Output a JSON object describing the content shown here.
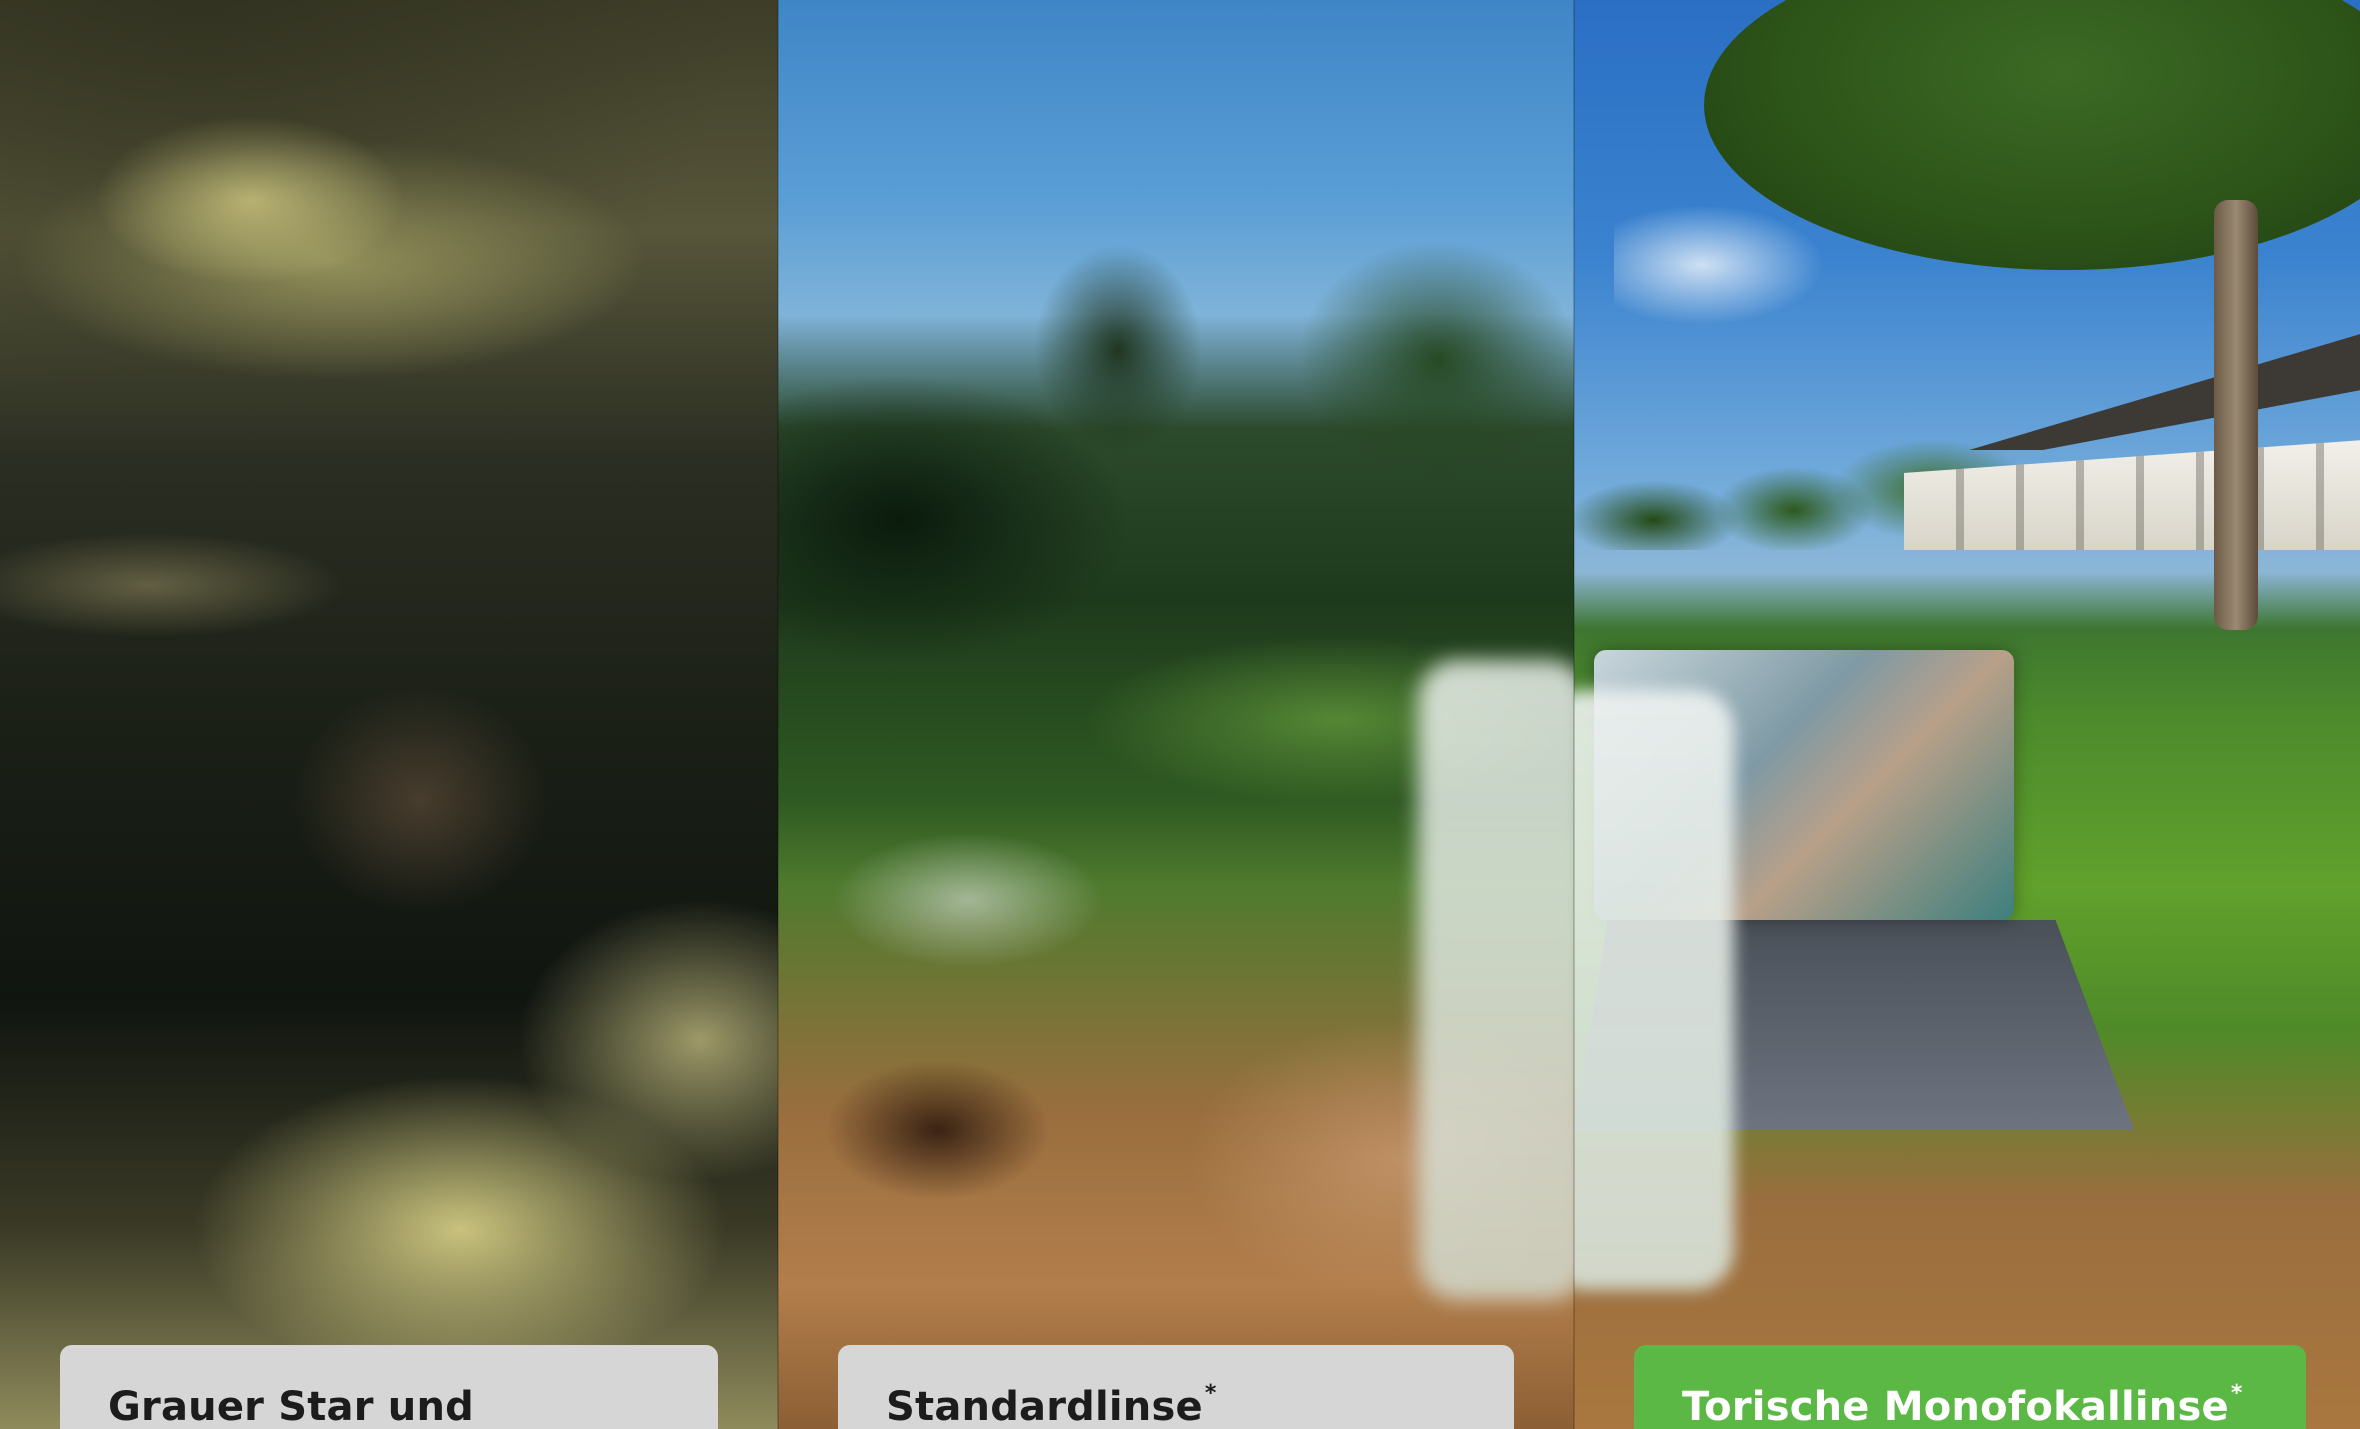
{
  "panels": [
    {
      "id": "cataract",
      "label": "Grauer Star und",
      "marker": "",
      "highlighted": false,
      "label_bg": "#d6d6d6",
      "label_color": "#1c1c1c"
    },
    {
      "id": "standard",
      "label": "Standardlinse",
      "marker": "*",
      "highlighted": false,
      "label_bg": "#d6d6d6",
      "label_color": "#1c1c1c"
    },
    {
      "id": "toric",
      "label": "Torische Monofokallinse",
      "marker": "*",
      "highlighted": true,
      "label_bg": "#5cb845",
      "label_color": "#ffffff"
    }
  ]
}
